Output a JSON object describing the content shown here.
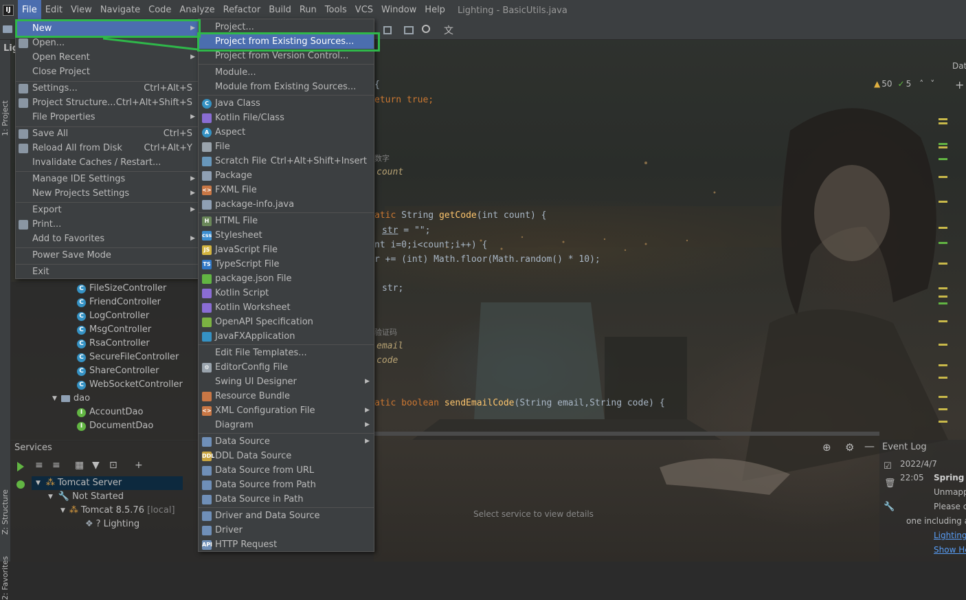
{
  "window_title": "Lighting - BasicUtils.java",
  "menubar": [
    "File",
    "Edit",
    "View",
    "Navigate",
    "Code",
    "Analyze",
    "Refactor",
    "Build",
    "Run",
    "Tools",
    "VCS",
    "Window",
    "Help"
  ],
  "left_tabs": {
    "project": "1: Project",
    "structure": "Z: Structure",
    "favorites": "2: Favorites"
  },
  "project_label": "Lig",
  "right_tab": "Dat",
  "file_menu": [
    {
      "label": "New",
      "shortcut": "",
      "arrow": true,
      "selected": true
    },
    {
      "label": "Open...",
      "shortcut": "",
      "arrow": false
    },
    {
      "label": "Open Recent",
      "shortcut": "",
      "arrow": true
    },
    {
      "label": "Close Project",
      "shortcut": "",
      "arrow": false
    },
    {
      "label": "Settings...",
      "shortcut": "Ctrl+Alt+S",
      "arrow": false
    },
    {
      "label": "Project Structure...",
      "shortcut": "Ctrl+Alt+Shift+S",
      "arrow": false
    },
    {
      "label": "File Properties",
      "shortcut": "",
      "arrow": true
    },
    {
      "label": "Save All",
      "shortcut": "Ctrl+S",
      "arrow": false
    },
    {
      "label": "Reload All from Disk",
      "shortcut": "Ctrl+Alt+Y",
      "arrow": false
    },
    {
      "label": "Invalidate Caches / Restart...",
      "shortcut": "",
      "arrow": false
    },
    {
      "label": "Manage IDE Settings",
      "shortcut": "",
      "arrow": true
    },
    {
      "label": "New Projects Settings",
      "shortcut": "",
      "arrow": true
    },
    {
      "label": "Export",
      "shortcut": "",
      "arrow": true
    },
    {
      "label": "Print...",
      "shortcut": "",
      "arrow": false
    },
    {
      "label": "Add to Favorites",
      "shortcut": "",
      "arrow": true
    },
    {
      "label": "Power Save Mode",
      "shortcut": "",
      "arrow": false
    },
    {
      "label": "Exit",
      "shortcut": "",
      "arrow": false
    }
  ],
  "new_menu": [
    {
      "label": "Project...",
      "shortcut": "",
      "arrow": false,
      "icon": ""
    },
    {
      "label": "Project from Existing Sources...",
      "shortcut": "",
      "arrow": false,
      "icon": "",
      "selected": true
    },
    {
      "label": "Project from Version Control...",
      "shortcut": "",
      "arrow": false,
      "icon": ""
    },
    {
      "label": "Module...",
      "shortcut": "",
      "arrow": false,
      "icon": ""
    },
    {
      "label": "Module from Existing Sources...",
      "shortcut": "",
      "arrow": false,
      "icon": ""
    },
    {
      "label": "Java Class",
      "shortcut": "",
      "arrow": false,
      "icon": "java-class-icon"
    },
    {
      "label": "Kotlin File/Class",
      "shortcut": "",
      "arrow": false,
      "icon": "kotlin-icon"
    },
    {
      "label": "Aspect",
      "shortcut": "",
      "arrow": false,
      "icon": "aspect-icon"
    },
    {
      "label": "File",
      "shortcut": "",
      "arrow": false,
      "icon": "file-icon"
    },
    {
      "label": "Scratch File",
      "shortcut": "Ctrl+Alt+Shift+Insert",
      "arrow": false,
      "icon": "scratch-file-icon"
    },
    {
      "label": "Package",
      "shortcut": "",
      "arrow": false,
      "icon": "package-icon"
    },
    {
      "label": "FXML File",
      "shortcut": "",
      "arrow": false,
      "icon": "fxml-icon"
    },
    {
      "label": "package-info.java",
      "shortcut": "",
      "arrow": false,
      "icon": "package-info-icon"
    },
    {
      "label": "HTML File",
      "shortcut": "",
      "arrow": false,
      "icon": "html-icon"
    },
    {
      "label": "Stylesheet",
      "shortcut": "",
      "arrow": false,
      "icon": "css-icon"
    },
    {
      "label": "JavaScript File",
      "shortcut": "",
      "arrow": false,
      "icon": "js-icon"
    },
    {
      "label": "TypeScript File",
      "shortcut": "",
      "arrow": false,
      "icon": "ts-icon"
    },
    {
      "label": "package.json File",
      "shortcut": "",
      "arrow": false,
      "icon": "npm-icon"
    },
    {
      "label": "Kotlin Script",
      "shortcut": "",
      "arrow": false,
      "icon": "kotlin-script-icon"
    },
    {
      "label": "Kotlin Worksheet",
      "shortcut": "",
      "arrow": false,
      "icon": "kotlin-worksheet-icon"
    },
    {
      "label": "OpenAPI Specification",
      "shortcut": "",
      "arrow": false,
      "icon": "openapi-icon"
    },
    {
      "label": "JavaFXApplication",
      "shortcut": "",
      "arrow": false,
      "icon": "javafx-icon"
    },
    {
      "label": "Edit File Templates...",
      "shortcut": "",
      "arrow": false,
      "icon": ""
    },
    {
      "label": "EditorConfig File",
      "shortcut": "",
      "arrow": false,
      "icon": "gear-icon"
    },
    {
      "label": "Swing UI Designer",
      "shortcut": "",
      "arrow": true,
      "icon": ""
    },
    {
      "label": "Resource Bundle",
      "shortcut": "",
      "arrow": false,
      "icon": "resource-bundle-icon"
    },
    {
      "label": "XML Configuration File",
      "shortcut": "",
      "arrow": true,
      "icon": "xml-icon"
    },
    {
      "label": "Diagram",
      "shortcut": "",
      "arrow": true,
      "icon": ""
    },
    {
      "label": "Data Source",
      "shortcut": "",
      "arrow": true,
      "icon": "database-icon"
    },
    {
      "label": "DDL Data Source",
      "shortcut": "",
      "arrow": false,
      "icon": "ddl-icon"
    },
    {
      "label": "Data Source from URL",
      "shortcut": "",
      "arrow": false,
      "icon": "database-url-icon"
    },
    {
      "label": "Data Source from Path",
      "shortcut": "",
      "arrow": false,
      "icon": "database-path-icon"
    },
    {
      "label": "Data Source in Path",
      "shortcut": "",
      "arrow": false,
      "icon": "database-path-icon"
    },
    {
      "label": "Driver and Data Source",
      "shortcut": "",
      "arrow": false,
      "icon": "driver-icon"
    },
    {
      "label": "Driver",
      "shortcut": "",
      "arrow": false,
      "icon": "driver-icon"
    },
    {
      "label": "HTTP Request",
      "shortcut": "",
      "arrow": false,
      "icon": "http-icon"
    }
  ],
  "tree": {
    "items": [
      "FileSizeController",
      "FriendController",
      "LogController",
      "MsgController",
      "RsaController",
      "SecureFileController",
      "ShareController",
      "WebSocketController"
    ],
    "folder": "dao",
    "dao_items": [
      "AccountDao",
      "DocumentDao"
    ]
  },
  "editor": {
    "inspections": {
      "warnings": "50",
      "checks": "5"
    },
    "lines": {
      "l1": "{",
      "l2_kw": "eturn true;",
      "c1": "数字",
      "p1": "count",
      "sig_kw": "atic",
      "sig_type": "String",
      "sig_fn": "getCode",
      "sig_rest": "(int count) {",
      "l_str": "str",
      "l_str_rest": " = \"\";",
      "l_for": "nt i=0;i<count;i++) {",
      "l_add": "r += (int) Math.floor(Math.random() * 10);",
      "l_ret": "str;",
      "c2": "验证码",
      "p2": "email",
      "p3": "code",
      "sig2_kw": "atic boolean",
      "sig2_fn": "sendEmailCode",
      "sig2_rest": "(String email,String code) {"
    }
  },
  "services": {
    "title": "Services",
    "tomcat_server": "Tomcat Server",
    "not_started": "Not Started",
    "tomcat": "Tomcat 8.5.76",
    "local": "[local]",
    "lighting": "Lighting",
    "placeholder": "Select service to view details"
  },
  "event_log": {
    "title": "Event Log",
    "date": "2022/4/7",
    "time": "22:05",
    "heading": "Spring C",
    "line1": "Unmapp",
    "line2": "Please c",
    "line3": "one including a",
    "link1": "Lighting",
    "link2": "Show He"
  }
}
